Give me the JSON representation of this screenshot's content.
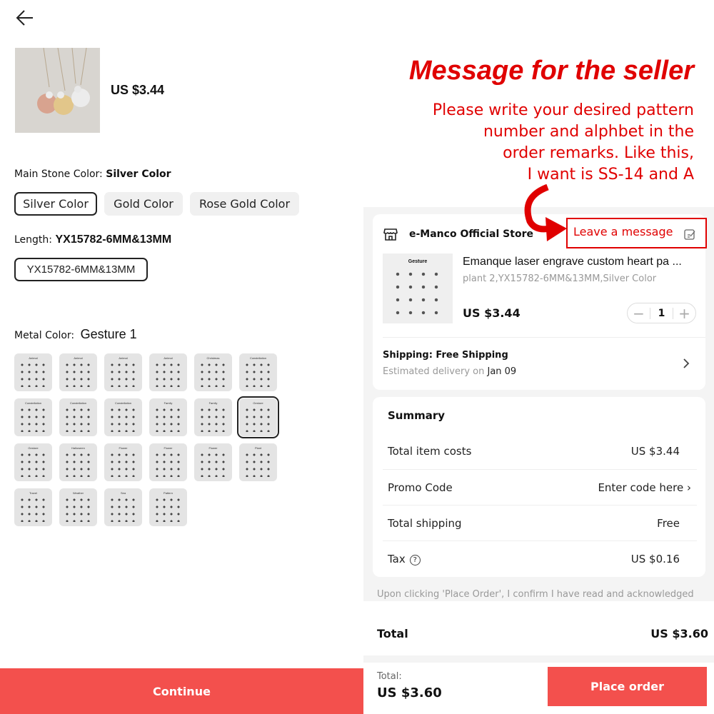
{
  "left": {
    "price": "US $3.44",
    "main_stone": {
      "label": "Main Stone Color:",
      "value": "Silver Color",
      "options": [
        "Silver Color",
        "Gold Color",
        "Rose Gold Color"
      ],
      "selected": "Silver Color"
    },
    "length": {
      "label": "Length:",
      "value": "YX15782-6MM&13MM",
      "option": "YX15782-6MM&13MM"
    },
    "metal": {
      "label": "Metal Color:",
      "value": "Gesture 1",
      "swatches": [
        "Animal",
        "Animal",
        "Animal",
        "Animal",
        "Christmas",
        "Constellation",
        "Constellation",
        "Constellation",
        "Constellation",
        "Family",
        "Family",
        "Gesture",
        "Gesture",
        "Halloween",
        "Flower",
        "Flower",
        "Flower",
        "Plant",
        "Travel",
        "Weather",
        "Sea",
        "Pattern"
      ],
      "selected_index": 11
    },
    "continue_label": "Continue"
  },
  "annotation": {
    "title": "Message for the seller",
    "body": [
      "Please write your desired pattern",
      "number and alphbet in the",
      "order remarks. Like this,",
      "I want is SS-14 and A"
    ],
    "color": "#e00000"
  },
  "right": {
    "store_name": "e-Manco Official Store",
    "leave_message": "Leave a message",
    "item": {
      "image_title": "Gesture",
      "title": "Emanque laser engrave custom heart pa ...",
      "variant": "plant 2,YX15782-6MM&13MM,Silver Color",
      "price": "US $3.44",
      "quantity": "1"
    },
    "shipping": {
      "label": "Shipping: Free Shipping",
      "estimate_prefix": "Estimated delivery on",
      "date": "Jan 09"
    },
    "summary": {
      "title": "Summary",
      "rows": [
        {
          "label": "Total item costs",
          "value": "US $3.44"
        },
        {
          "label": "Promo Code",
          "value": "Enter code here"
        },
        {
          "label": "Total shipping",
          "value": "Free"
        },
        {
          "label": "Tax",
          "value": "US $0.16"
        }
      ]
    },
    "disclaimer": "Upon clicking 'Place Order', I confirm I have read and acknowledged",
    "total_label": "Total",
    "total_value": "US $3.60",
    "bottom_total_label": "Total:",
    "bottom_total_value": "US $3.60",
    "place_order": "Place order",
    "accent_color": "#f3504d"
  }
}
